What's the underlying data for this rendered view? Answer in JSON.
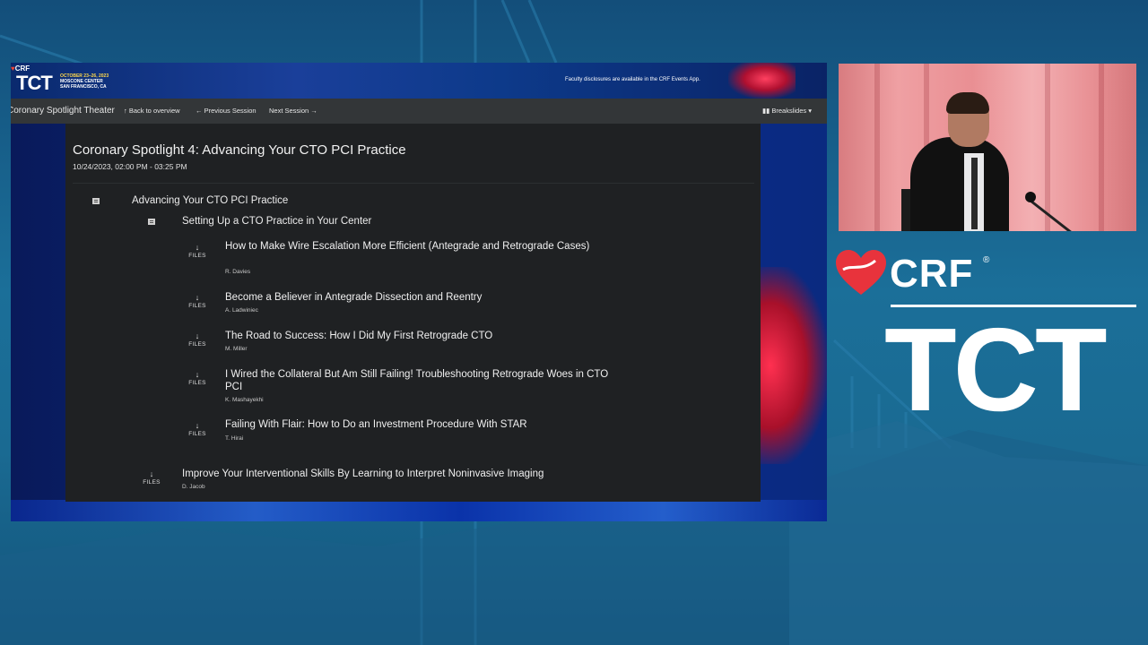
{
  "banner": {
    "crf_label": "CRF",
    "tct_label": "TCT",
    "dates": "OCTOBER 23–26, 2023",
    "venue_line1": "MOSCONE CENTER",
    "venue_line2": "SAN FRANCISCO, CA",
    "disclosure": "Faculty disclosures are available in the CRF Events App."
  },
  "nav": {
    "title": "Coronary Spotlight Theater",
    "back": "Back to overview",
    "prev": "Previous Session",
    "next": "Next Session",
    "breakslides": "Breakslides"
  },
  "session": {
    "title": "Coronary Spotlight 4: Advancing Your CTO PCI Practice",
    "datetime": "10/24/2023, 02:00 PM - 03:25 PM"
  },
  "groups": [
    {
      "title": "Advancing Your CTO PCI Practice"
    },
    {
      "title": "Setting Up a CTO Practice in Your Center"
    }
  ],
  "files_label": "FILES",
  "talks": [
    {
      "title": "How to Make Wire Escalation More Efficient (Antegrade and Retrograde Cases)",
      "author": "R. Davies"
    },
    {
      "title": "Become a Believer in Antegrade Dissection and Reentry",
      "author": "A. Ladwiniec"
    },
    {
      "title": "The Road to Success: How I Did My First Retrograde CTO",
      "author": "M. Miller"
    },
    {
      "title": "I Wired the Collateral But Am Still Failing! Troubleshooting Retrograde Woes in CTO PCI",
      "author": "K. Mashayekhi"
    },
    {
      "title": "Failing With Flair: How to Do an Investment Procedure With STAR",
      "author": "T. Hirai"
    },
    {
      "title": "Improve Your Interventional Skills By Learning to Interpret Noninvasive Imaging",
      "author": "D. Jacob"
    }
  ],
  "brand": {
    "crf": "CRF",
    "registered": "®",
    "tct": "TCT",
    "heart_color": "#e8333c"
  }
}
